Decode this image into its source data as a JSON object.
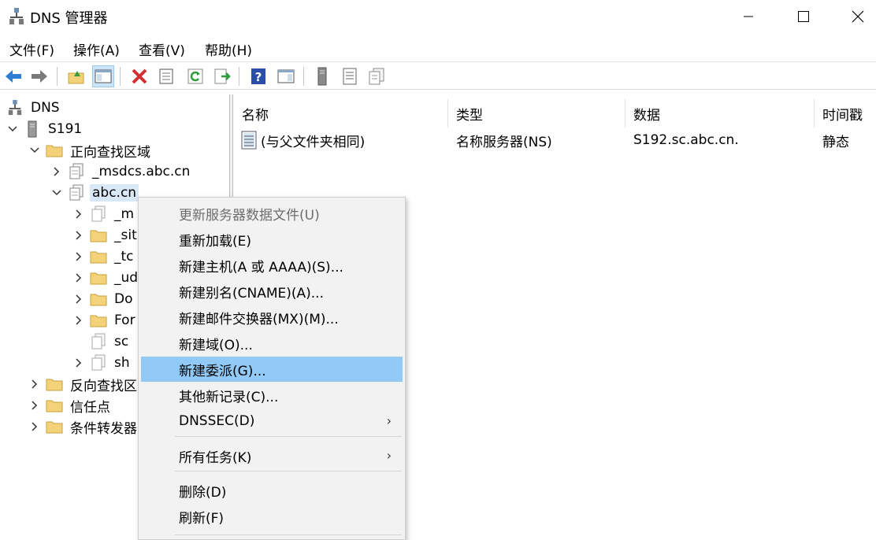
{
  "window": {
    "title": "DNS 管理器",
    "minimize_glyph": "—",
    "maximize_glyph": "☐",
    "close_glyph": "✕"
  },
  "menubar": [
    "文件(F)",
    "操作(A)",
    "查看(V)",
    "帮助(H)"
  ],
  "tree": {
    "root": "DNS",
    "server": "S191",
    "forward_zones": "正向查找区域",
    "msdcs": "_msdcs.abc.cn",
    "abc": "abc.cn",
    "children": [
      "_m",
      "_sit",
      "_tc",
      "_ud",
      "Do",
      "For",
      "sc",
      "sh"
    ],
    "reverse_zones": "反向查找区",
    "trust_points": "信任点",
    "conditional_forwarders": "条件转发器"
  },
  "list": {
    "columns": [
      "名称",
      "类型",
      "数据",
      "时间戳"
    ],
    "rows": [
      {
        "name": "(与父文件夹相同)",
        "type": "名称服务器(NS)",
        "data": "S192.sc.abc.cn.",
        "timestamp": "静态"
      }
    ]
  },
  "context_menu": {
    "items": [
      "更新服务器数据文件(U)",
      "重新加载(E)",
      "新建主机(A 或 AAAA)(S)...",
      "新建别名(CNAME)(A)...",
      "新建邮件交换器(MX)(M)...",
      "新建域(O)...",
      "新建委派(G)...",
      "其他新记录(C)...",
      "DNSSEC(D)",
      "所有任务(K)",
      "删除(D)",
      "刷新(F)"
    ],
    "submenu_arrow": "›",
    "highlighted": "新建委派(G)...",
    "disabled": "更新服务器数据文件(U)"
  },
  "colors": {
    "highlight": "#91c9f7",
    "selection": "#d9e8f7",
    "folder": "#f3d27a",
    "delete_red": "#d32f2f",
    "nav_blue": "#2d7dd2"
  }
}
